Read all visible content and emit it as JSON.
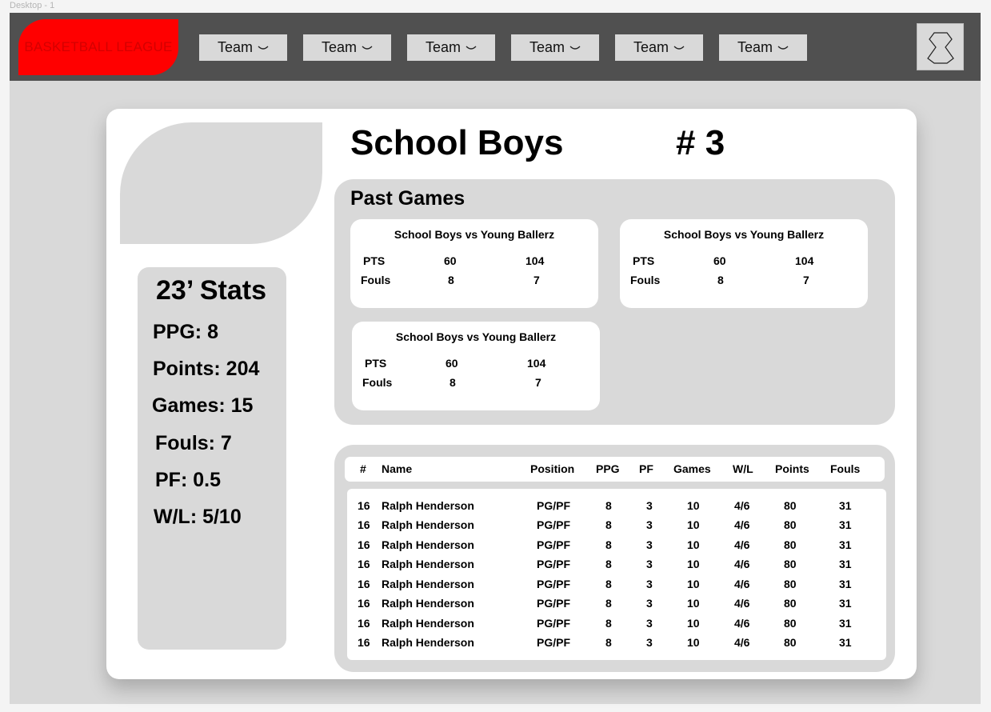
{
  "frame_label": "Desktop - 1",
  "nav": {
    "logo_text": "BASKETBALL LEAGUE",
    "team_buttons": [
      "Team",
      "Team",
      "Team",
      "Team",
      "Team",
      "Team"
    ],
    "profile_icon": "jersey-icon"
  },
  "team": {
    "name": "School Boys",
    "rank": "# 3"
  },
  "stats": {
    "title": "23’ Stats",
    "lines": [
      "PPG: 8",
      "Points: 204",
      "Games: 15",
      "Fouls: 7",
      "PF: 0.5",
      "W/L: 5/10"
    ]
  },
  "past_games": {
    "title": "Past Games",
    "games": [
      {
        "title": "School Boys vs Young Ballerz",
        "row1_label": "PTS",
        "row1_home": "60",
        "row1_away": "104",
        "row2_label": "Fouls",
        "row2_home": "8",
        "row2_away": "7"
      },
      {
        "title": "School Boys vs Young Ballerz",
        "row1_label": "PTS",
        "row1_home": "60",
        "row1_away": "104",
        "row2_label": "Fouls",
        "row2_home": "8",
        "row2_away": "7"
      },
      {
        "title": "School Boys vs Young Ballerz",
        "row1_label": "PTS",
        "row1_home": "60",
        "row1_away": "104",
        "row2_label": "Fouls",
        "row2_home": "8",
        "row2_away": "7"
      }
    ]
  },
  "roster": {
    "columns": [
      "#",
      "Name",
      "Position",
      "PPG",
      "PF",
      "Games",
      "W/L",
      "Points",
      "Fouls"
    ],
    "rows": [
      [
        "16",
        "Ralph Henderson",
        "PG/PF",
        "8",
        "3",
        "10",
        "4/6",
        "80",
        "31"
      ],
      [
        "16",
        "Ralph Henderson",
        "PG/PF",
        "8",
        "3",
        "10",
        "4/6",
        "80",
        "31"
      ],
      [
        "16",
        "Ralph Henderson",
        "PG/PF",
        "8",
        "3",
        "10",
        "4/6",
        "80",
        "31"
      ],
      [
        "16",
        "Ralph Henderson",
        "PG/PF",
        "8",
        "3",
        "10",
        "4/6",
        "80",
        "31"
      ],
      [
        "16",
        "Ralph Henderson",
        "PG/PF",
        "8",
        "3",
        "10",
        "4/6",
        "80",
        "31"
      ],
      [
        "16",
        "Ralph Henderson",
        "PG/PF",
        "8",
        "3",
        "10",
        "4/6",
        "80",
        "31"
      ],
      [
        "16",
        "Ralph Henderson",
        "PG/PF",
        "8",
        "3",
        "10",
        "4/6",
        "80",
        "31"
      ],
      [
        "16",
        "Ralph Henderson",
        "PG/PF",
        "8",
        "3",
        "10",
        "4/6",
        "80",
        "31"
      ]
    ]
  },
  "colors": {
    "topbar": "#505050",
    "logo_bg": "#ff0000",
    "panel": "#d9d9d9"
  }
}
